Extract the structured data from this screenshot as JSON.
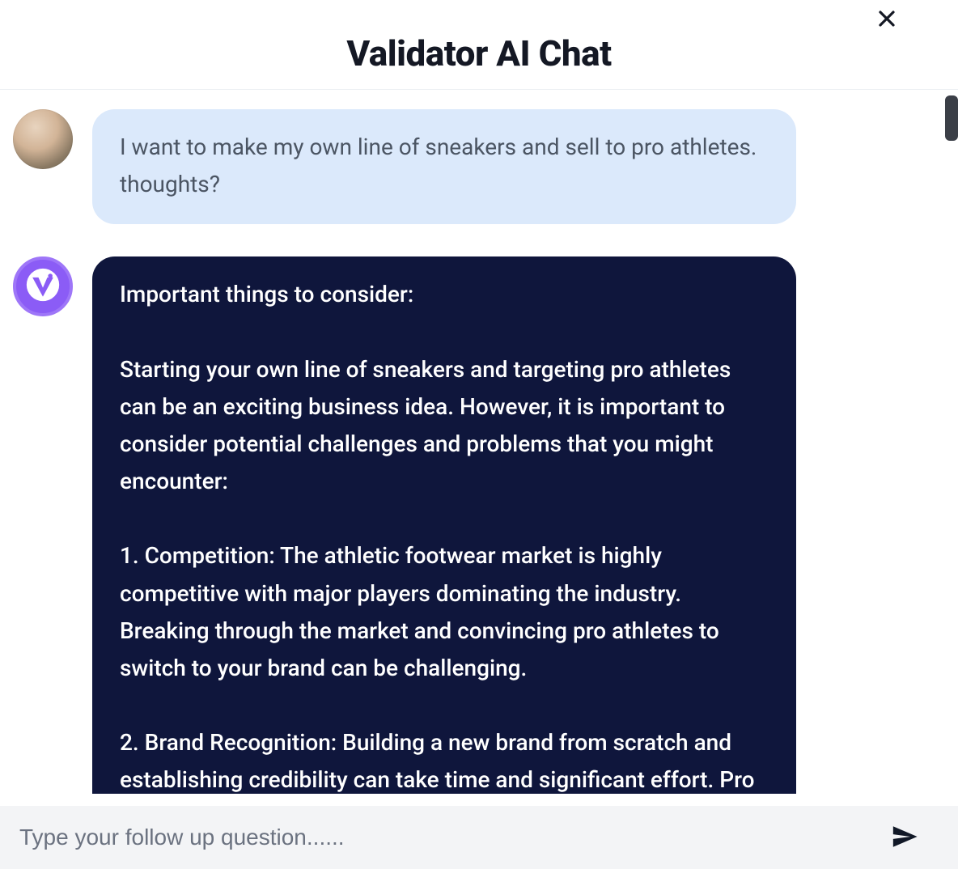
{
  "header": {
    "title": "Validator AI Chat",
    "close_label": "Close"
  },
  "messages": {
    "user": {
      "text": "I want to make my own line of sneakers and sell to pro athletes. thoughts?"
    },
    "bot": {
      "heading": "Important things to consider:",
      "p1": "Starting your own line of sneakers and targeting pro athletes can be an exciting business idea. However, it is important to consider potential challenges and problems that you might encounter:",
      "p2": "1. Competition: The athletic footwear market is highly competitive with major players dominating the industry. Breaking through the market and convincing pro athletes to switch to your brand can be challenging.",
      "p3": "2. Brand Recognition: Building a new brand from scratch and establishing credibility can take time and significant effort. Pro"
    }
  },
  "input": {
    "placeholder": "Type your follow up question......",
    "value": ""
  },
  "icons": {
    "close": "close-icon",
    "send": "paper-plane-icon",
    "bot_logo": "validator-logo-icon",
    "user_avatar": "user-avatar"
  },
  "colors": {
    "user_bubble_bg": "#dbe9fb",
    "bot_bubble_bg": "#0f163c",
    "bot_avatar_bg": "#8b5cf6",
    "input_bar_bg": "#f3f4f6"
  }
}
